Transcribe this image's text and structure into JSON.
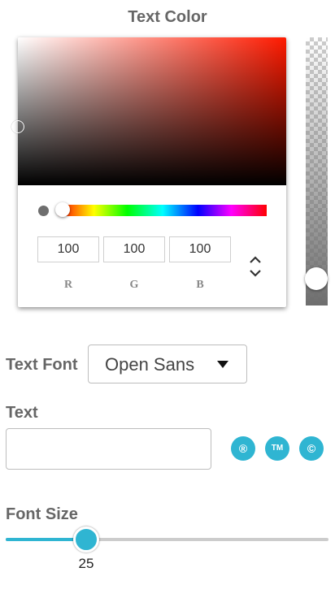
{
  "title": "Text Color",
  "color_picker": {
    "hue_color": "#ff1a00",
    "current_color": "#6e6e6e",
    "rgb": {
      "r": "100",
      "g": "100",
      "b": "100",
      "labels": {
        "r": "R",
        "g": "G",
        "b": "B"
      }
    },
    "toggle_icon": "chevron-up-down-icon",
    "alpha_icon": "checkerboard-alpha"
  },
  "text_font": {
    "label": "Text Font",
    "selected": "Open Sans"
  },
  "text": {
    "label": "Text",
    "value": "",
    "symbols": [
      {
        "name": "registered",
        "glyph": "®"
      },
      {
        "name": "trademark",
        "glyph": "TM"
      },
      {
        "name": "copyright",
        "glyph": "©"
      }
    ]
  },
  "font_size": {
    "label": "Font Size",
    "value": "25",
    "accent": "#2fb5d2"
  }
}
